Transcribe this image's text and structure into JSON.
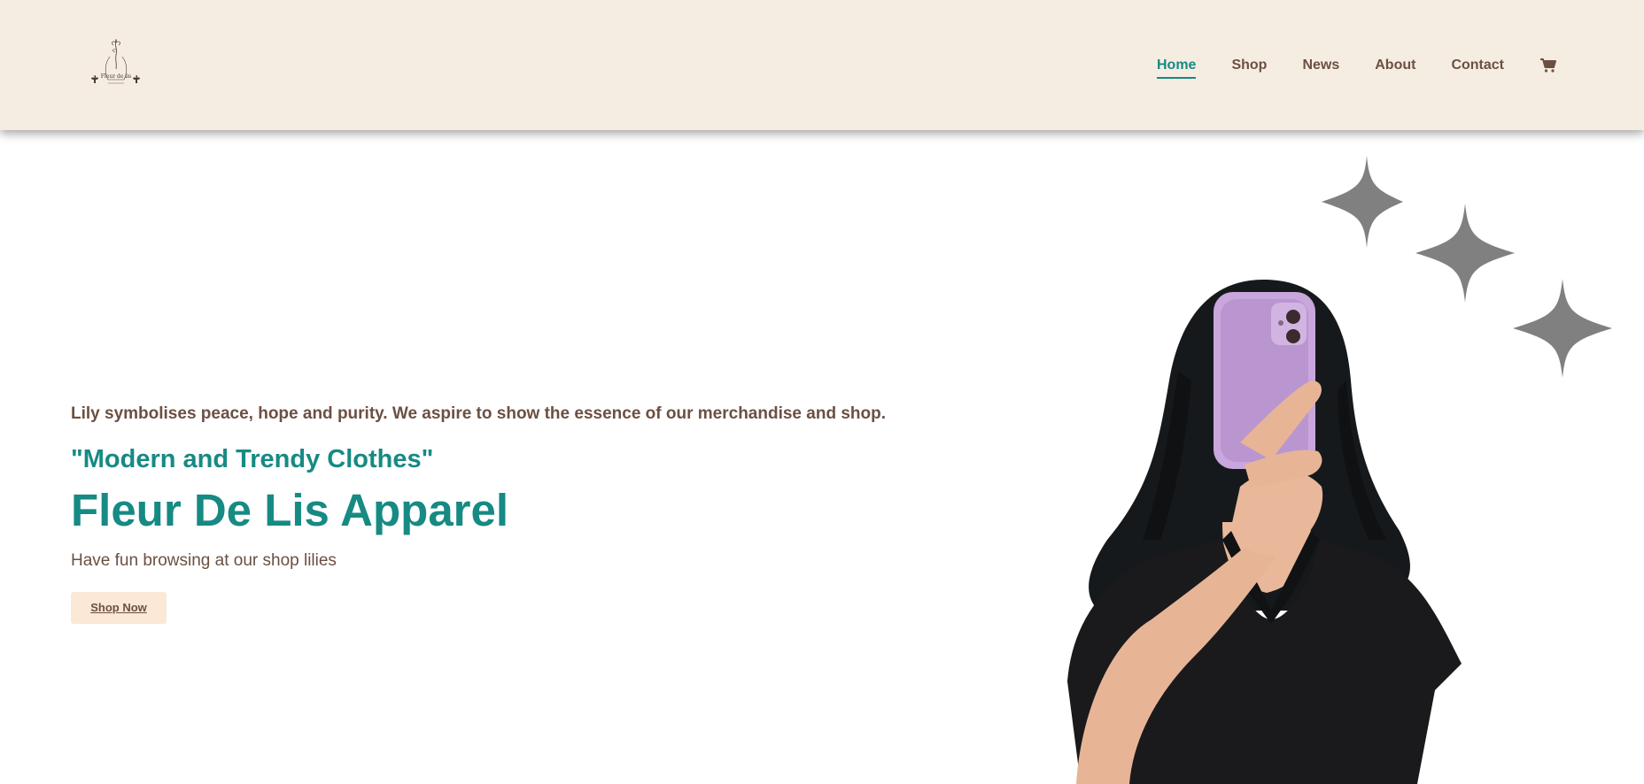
{
  "brand": {
    "logo_text": "Fleur de lis"
  },
  "nav": {
    "items": [
      {
        "label": "Home",
        "active": true
      },
      {
        "label": "Shop",
        "active": false
      },
      {
        "label": "News",
        "active": false
      },
      {
        "label": "About",
        "active": false
      },
      {
        "label": "Contact",
        "active": false
      }
    ],
    "cart_icon": "shopping-cart-icon"
  },
  "hero": {
    "tagline": "Lily symbolises peace, hope and purity. We aspire to show the essence of our merchandise and shop.",
    "quote": "\"Modern and Trendy Clothes\"",
    "title": "Fleur De Lis Apparel",
    "subtitle": "Have fun browsing at our shop lilies",
    "cta_label": "Shop Now"
  },
  "decorations": {
    "sparkle_icon": "four-point-star-icon",
    "sparkle_count": 3
  },
  "colors": {
    "header_bg": "#f6ede2",
    "accent_teal": "#168a83",
    "text_brown": "#6b5042",
    "button_bg": "#fbe8d6",
    "sparkle_gray": "#808080"
  }
}
